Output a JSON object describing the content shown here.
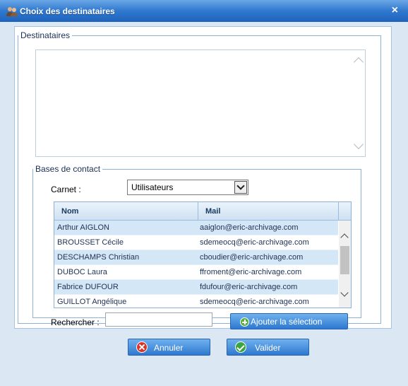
{
  "window": {
    "title": "Choix des destinataires",
    "close_label": "×"
  },
  "destinataires": {
    "legend": "Destinataires",
    "value": ""
  },
  "bases": {
    "legend": "Bases de contact",
    "carnet_label": "Carnet :",
    "carnet_value": "Utilisateurs",
    "columns": {
      "nom": "Nom",
      "mail": "Mail"
    },
    "rows": [
      {
        "nom": "Arthur AIGLON",
        "mail": "aaiglon@eric-archivage.com"
      },
      {
        "nom": "BROUSSET Cécile",
        "mail": "sdemeocq@eric-archivage.com"
      },
      {
        "nom": "DESCHAMPS Christian",
        "mail": "cboudier@eric-archivage.com"
      },
      {
        "nom": "DUBOC Laura",
        "mail": "ffroment@eric-archivage.com"
      },
      {
        "nom": "Fabrice DUFOUR",
        "mail": "fdufour@eric-archivage.com"
      },
      {
        "nom": "GUILLOT Angélique",
        "mail": "sdemeocq@eric-archivage.com"
      }
    ],
    "search_label": "Rechercher :",
    "search_value": "",
    "add_label": "Ajouter la sélection"
  },
  "actions": {
    "cancel_label": "Annuler",
    "validate_label": "Valider"
  },
  "colors": {
    "titlebar": "#2f78cf",
    "button": "#2d79d0",
    "row_alt": "#d4e7f7",
    "cancel_icon": "#d8352a",
    "ok_icon": "#3ba540"
  }
}
